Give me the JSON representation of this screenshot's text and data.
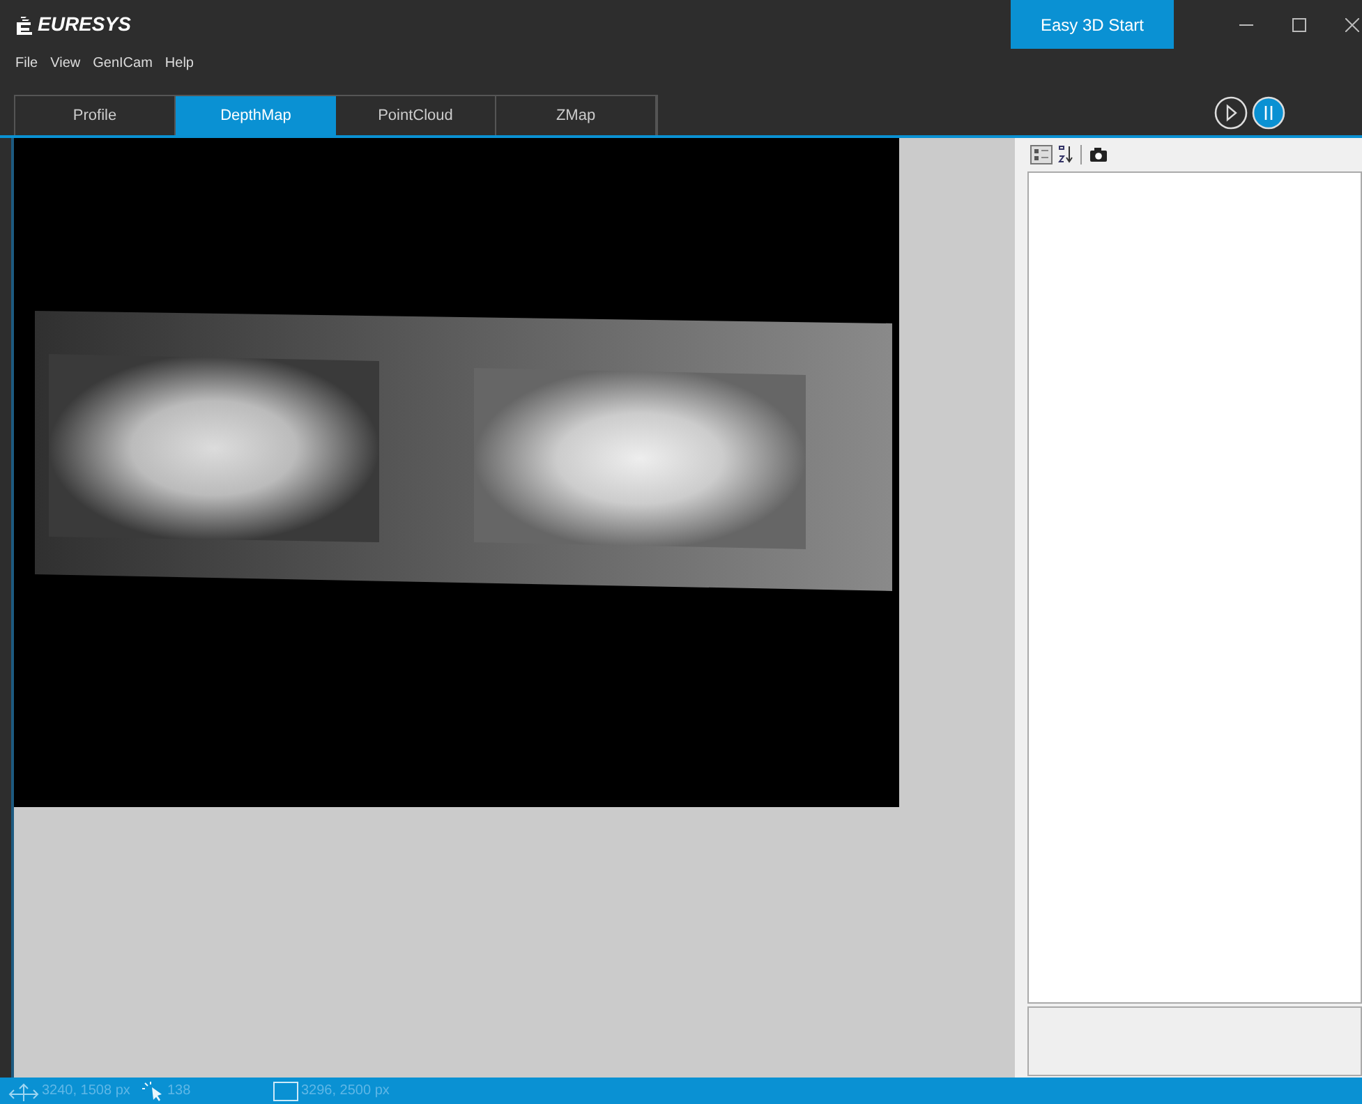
{
  "window": {
    "logo": "EURESYS",
    "action_button": "Easy 3D Start"
  },
  "menu": [
    "File",
    "View",
    "GenICam",
    "Help"
  ],
  "tabs": [
    {
      "label": "Profile",
      "selected": false
    },
    {
      "label": "DepthMap",
      "selected": true
    },
    {
      "label": "PointCloud",
      "selected": false
    },
    {
      "label": "ZMap",
      "selected": false
    }
  ],
  "status_bar": {
    "position": "3240, 1508 px",
    "points": "138",
    "size": "3296, 2500 px"
  }
}
